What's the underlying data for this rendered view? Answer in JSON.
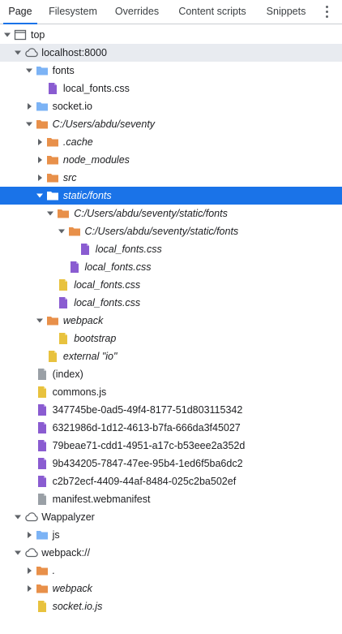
{
  "tabs": [
    {
      "label": "Page",
      "active": true
    },
    {
      "label": "Filesystem",
      "active": false
    },
    {
      "label": "Overrides",
      "active": false
    },
    {
      "label": "Content scripts",
      "active": false
    },
    {
      "label": "Snippets",
      "active": false
    }
  ],
  "colors": {
    "accent": "#1a73e8",
    "folder_network": "#7cb3f5",
    "folder_orange": "#e8904a",
    "file_purple": "#8a5cd1",
    "file_yellow": "#e8c23e",
    "file_gray": "#9aa0a6",
    "hover_row": "#e8ebf0"
  },
  "tree": [
    {
      "label": "top",
      "icon": "frame-icon",
      "arrow": "expanded",
      "depth": 0,
      "italic": false
    },
    {
      "label": "localhost:8000",
      "icon": "cloud-icon",
      "arrow": "expanded",
      "depth": 1,
      "italic": false,
      "highlight": "gray"
    },
    {
      "label": "fonts",
      "icon": "folder-blue-icon",
      "arrow": "expanded",
      "depth": 2,
      "italic": false
    },
    {
      "label": "local_fonts.css",
      "icon": "file-purple-icon",
      "arrow": "none",
      "depth": 3,
      "italic": false
    },
    {
      "label": "socket.io",
      "icon": "folder-blue-icon",
      "arrow": "collapsed",
      "depth": 2,
      "italic": false
    },
    {
      "label": "C:/Users/abdu/seventy",
      "icon": "folder-orange-icon",
      "arrow": "expanded",
      "depth": 2,
      "italic": true
    },
    {
      "label": ".cache",
      "icon": "folder-orange-icon",
      "arrow": "collapsed",
      "depth": 3,
      "italic": true
    },
    {
      "label": "node_modules",
      "icon": "folder-orange-icon",
      "arrow": "collapsed",
      "depth": 3,
      "italic": true
    },
    {
      "label": "src",
      "icon": "folder-orange-icon",
      "arrow": "collapsed",
      "depth": 3,
      "italic": true
    },
    {
      "label": "static/fonts",
      "icon": "folder-white-icon",
      "arrow": "expanded",
      "depth": 3,
      "italic": true,
      "highlight": "selected"
    },
    {
      "label": "C:/Users/abdu/seventy/static/fonts",
      "icon": "folder-orange-icon",
      "arrow": "expanded",
      "depth": 4,
      "italic": true
    },
    {
      "label": "C:/Users/abdu/seventy/static/fonts",
      "icon": "folder-orange-icon",
      "arrow": "expanded",
      "depth": 5,
      "italic": true
    },
    {
      "label": "local_fonts.css",
      "icon": "file-purple-icon",
      "arrow": "none",
      "depth": 6,
      "italic": true
    },
    {
      "label": "local_fonts.css",
      "icon": "file-purple-icon",
      "arrow": "none",
      "depth": 5,
      "italic": true
    },
    {
      "label": "local_fonts.css",
      "icon": "file-yellow-icon",
      "arrow": "none",
      "depth": 4,
      "italic": true
    },
    {
      "label": "local_fonts.css",
      "icon": "file-purple-icon",
      "arrow": "none",
      "depth": 4,
      "italic": true
    },
    {
      "label": "webpack",
      "icon": "folder-orange-icon",
      "arrow": "expanded",
      "depth": 3,
      "italic": true
    },
    {
      "label": "bootstrap",
      "icon": "file-yellow-icon",
      "arrow": "none",
      "depth": 4,
      "italic": true
    },
    {
      "label": "external \"io\"",
      "icon": "file-yellow-icon",
      "arrow": "none",
      "depth": 3,
      "italic": true
    },
    {
      "label": "(index)",
      "icon": "file-gray-icon",
      "arrow": "none",
      "depth": 2,
      "italic": false
    },
    {
      "label": "commons.js",
      "icon": "file-yellow-icon",
      "arrow": "none",
      "depth": 2,
      "italic": false
    },
    {
      "label": "347745be-0ad5-49f4-8177-51d803115342",
      "icon": "file-purple-icon",
      "arrow": "none",
      "depth": 2,
      "italic": false
    },
    {
      "label": "6321986d-1d12-4613-b7fa-666da3f45027",
      "icon": "file-purple-icon",
      "arrow": "none",
      "depth": 2,
      "italic": false
    },
    {
      "label": "79beae71-cdd1-4951-a17c-b53eee2a352d",
      "icon": "file-purple-icon",
      "arrow": "none",
      "depth": 2,
      "italic": false
    },
    {
      "label": "9b434205-7847-47ee-95b4-1ed6f5ba6dc2",
      "icon": "file-purple-icon",
      "arrow": "none",
      "depth": 2,
      "italic": false
    },
    {
      "label": "c2b72ecf-4409-44af-8484-025c2ba502ef",
      "icon": "file-purple-icon",
      "arrow": "none",
      "depth": 2,
      "italic": false
    },
    {
      "label": "manifest.webmanifest",
      "icon": "file-gray-icon",
      "arrow": "none",
      "depth": 2,
      "italic": false
    },
    {
      "label": "Wappalyzer",
      "icon": "cloud-icon",
      "arrow": "expanded",
      "depth": 1,
      "italic": false
    },
    {
      "label": "js",
      "icon": "folder-blue-icon",
      "arrow": "collapsed",
      "depth": 2,
      "italic": false
    },
    {
      "label": "webpack://",
      "icon": "cloud-icon",
      "arrow": "expanded",
      "depth": 1,
      "italic": false
    },
    {
      "label": ".",
      "icon": "folder-orange-icon",
      "arrow": "collapsed",
      "depth": 2,
      "italic": true
    },
    {
      "label": "webpack",
      "icon": "folder-orange-icon",
      "arrow": "collapsed",
      "depth": 2,
      "italic": true
    },
    {
      "label": "socket.io.js",
      "icon": "file-yellow-icon",
      "arrow": "none",
      "depth": 2,
      "italic": true
    }
  ]
}
